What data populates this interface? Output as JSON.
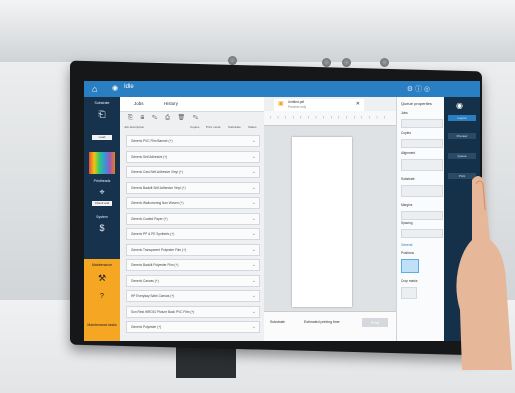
{
  "app": {
    "title": "Idle"
  },
  "sidebar": {
    "substrate": "Substrate",
    "load": "Load",
    "printheads": "Printheads",
    "check_clean": "Check and clean",
    "system": "System",
    "maintenance": "Maintenance",
    "info": "Maintenance tasks"
  },
  "joblist": {
    "tabs": [
      "Jobs",
      "History"
    ],
    "head": [
      "Job description",
      "Copies",
      "Print mode",
      "Substrate",
      "Status"
    ],
    "rows": [
      "Generic PVC Film Banner (+)",
      "Generic Self Adhesive (+)",
      "Generic Cast Self-Adhesive Vinyl (+)",
      "Generic Backlit Self-Adhesive Vinyl (+)",
      "Generic Wallcovering Non Woven (+)",
      "Generic Coated Paper (+)",
      "Generic PP & PE Synthetic (+)",
      "Generic Transparent Polyester Film (+)",
      "Generic Backlit Polyester Film (+)",
      "Generic Canvas (+)",
      "HP Everyday Satin Canvas (+)",
      "Sun Rest WRO10 Picture Back PVC Film (+)",
      "Generic Polyester (+)"
    ]
  },
  "preview": {
    "file_name": "Untitled.pdf",
    "file_sub": "Preview only",
    "footer_left": "Substrate",
    "footer_right": "Estimated printing time",
    "print_button": "Print"
  },
  "queue": {
    "title": "Queue properties",
    "jobs": "Jobs",
    "copies": "Copies",
    "alignment": "Alignment",
    "substrate": "Substrate",
    "margins": "Margins",
    "spacing": "Spacing",
    "general": "General",
    "positions": "Positions",
    "crop_marks": "Crop marks"
  },
  "rightpanel": {
    "buttons": [
      "Layout",
      "Preview",
      "Queue",
      "Print"
    ]
  },
  "colors": {
    "topbar": "#2a7ec2",
    "sidebar": "#16324d",
    "accent": "#f5a623"
  }
}
